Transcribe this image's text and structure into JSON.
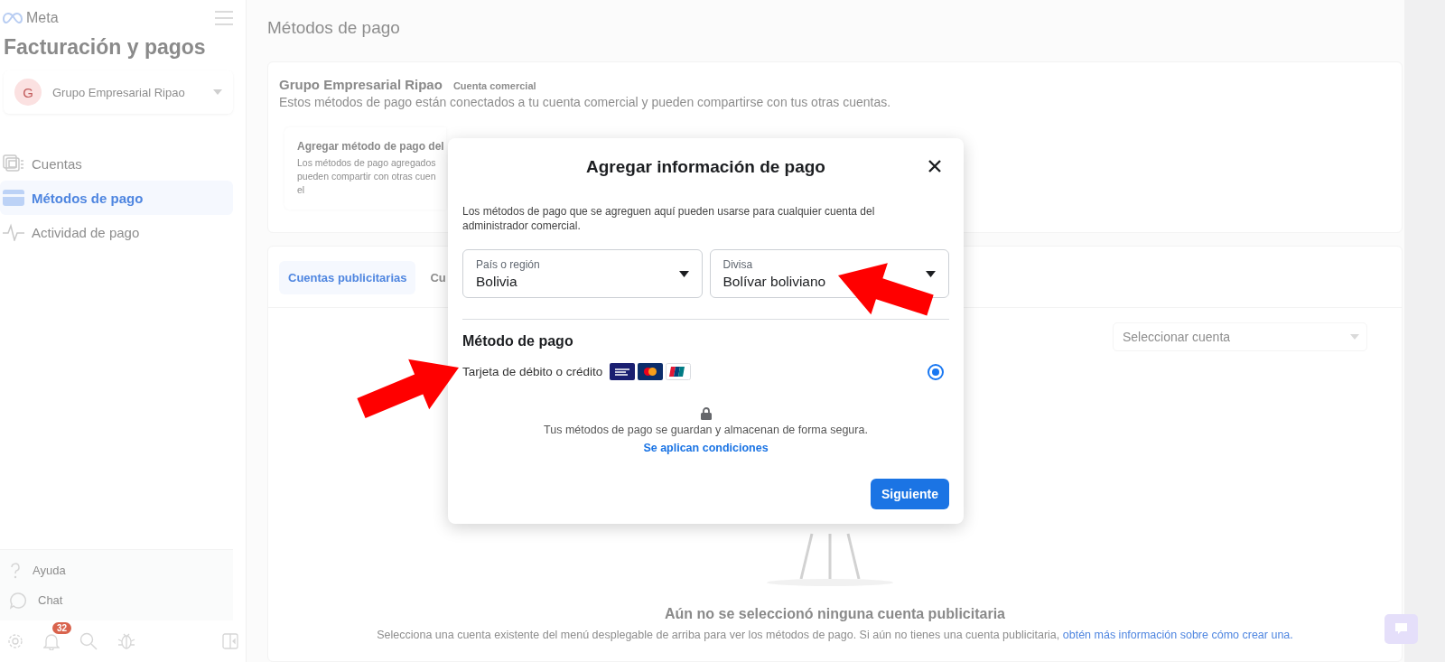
{
  "sidebar": {
    "logo": "Meta",
    "title": "Facturación y pagos",
    "account": {
      "initial": "G",
      "name": "Grupo Empresarial Ripao"
    },
    "nav": [
      {
        "label": "Cuentas",
        "selected": false
      },
      {
        "label": "Métodos de pago",
        "selected": true
      },
      {
        "label": "Actividad de pago",
        "selected": false
      }
    ],
    "footer_links": [
      {
        "label": "Ayuda"
      },
      {
        "label": "Chat"
      }
    ],
    "notification_count": "32"
  },
  "main": {
    "heading": "Métodos de pago",
    "business_card": {
      "name": "Grupo Empresarial Ripao",
      "badge": "Cuenta comercial",
      "description": "Estos métodos de pago están conectados a tu cuenta comercial y pueden compartirse con tus otras cuentas.",
      "add_card": {
        "title": "Agregar método de pago del",
        "lines": [
          "Los métodos de pago agregados",
          "pueden compartir con otras cuen",
          "el"
        ]
      }
    },
    "ad_accounts": {
      "tabs": [
        {
          "label": "Cuentas publicitarias",
          "selected": true
        },
        {
          "label": "Cu",
          "selected": false
        }
      ],
      "account_select": {
        "placeholder": "Seleccionar cuenta"
      },
      "empty_title": "Aún no se seleccionó ninguna cuenta publicitaria",
      "empty_text": "Selecciona una cuenta existente del menú desplegable de arriba para ver los métodos de pago. Si aún no tienes una cuenta publicitaria, ",
      "empty_link": "obtén más información sobre cómo crear una."
    }
  },
  "dialog": {
    "title": "Agregar información de pago",
    "description": "Los métodos de pago que se agreguen aquí pueden usarse para cualquier cuenta del administrador comercial.",
    "fields": [
      {
        "label": "País o región",
        "value": "Bolivia"
      },
      {
        "label": "Divisa",
        "value": "Bolívar boliviano"
      }
    ],
    "section_title": "Método de pago",
    "options": [
      {
        "label": "Tarjeta de débito o crédito",
        "selected": true
      }
    ],
    "security_note": "Tus métodos de pago se guardan y almacenan de forma segura.",
    "terms_link": "Se aplican condiciones",
    "next_button": "Siguiente"
  }
}
